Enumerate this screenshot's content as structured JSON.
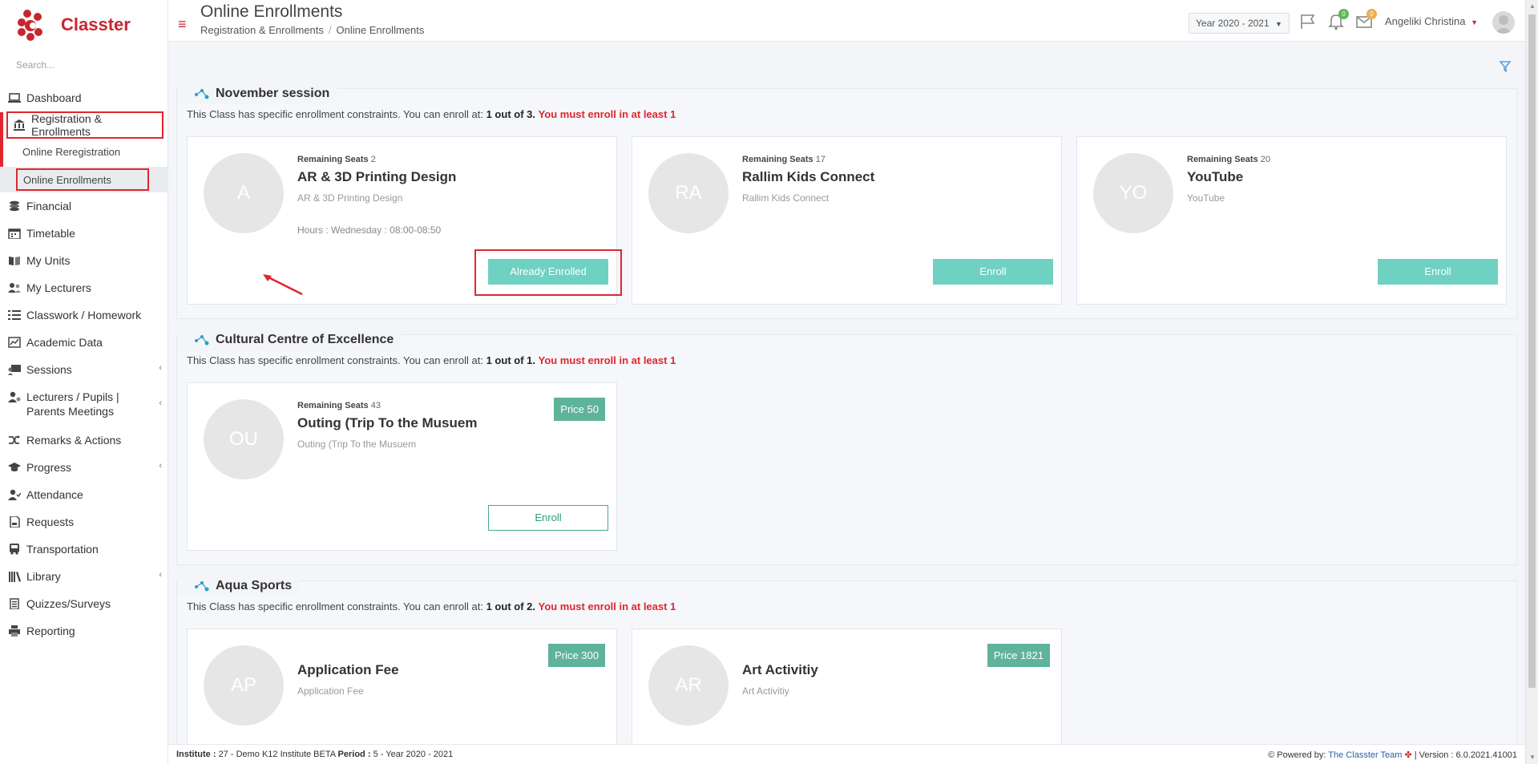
{
  "app": {
    "name": "Classter",
    "search_placeholder": "Search..."
  },
  "sidebar": {
    "items": [
      {
        "label": "Dashboard",
        "icon": "laptop-icon"
      },
      {
        "label": "Registration & Enrollments",
        "icon": "bank-icon"
      },
      {
        "label": "Financial",
        "icon": "coins-icon"
      },
      {
        "label": "Timetable",
        "icon": "calendar-icon"
      },
      {
        "label": "My Units",
        "icon": "book-icon"
      },
      {
        "label": "My Lecturers",
        "icon": "users-icon"
      },
      {
        "label": "Classwork / Homework",
        "icon": "list-icon"
      },
      {
        "label": "Academic Data",
        "icon": "chart-icon"
      },
      {
        "label": "Sessions",
        "icon": "presentation-icon"
      },
      {
        "label": "Lecturers / Pupils | Parents Meetings",
        "icon": "meeting-icon"
      },
      {
        "label": "Remarks & Actions",
        "icon": "shuffle-icon"
      },
      {
        "label": "Progress",
        "icon": "graduation-cap-icon"
      },
      {
        "label": "Attendance",
        "icon": "user-check-icon"
      },
      {
        "label": "Requests",
        "icon": "document-icon"
      },
      {
        "label": "Transportation",
        "icon": "bus-icon"
      },
      {
        "label": "Library",
        "icon": "library-icon"
      },
      {
        "label": "Quizzes/Surveys",
        "icon": "clipboard-icon"
      },
      {
        "label": "Reporting",
        "icon": "printer-icon"
      }
    ],
    "subitems": [
      {
        "label": "Online Reregistration"
      },
      {
        "label": "Online Enrollments"
      }
    ]
  },
  "header": {
    "title": "Online Enrollments",
    "breadcrumb": [
      "Registration & Enrollments",
      "Online Enrollments"
    ],
    "year": "Year 2020 - 2021",
    "notifications_count": "0",
    "messages_count": "0",
    "user_name": "Angeliki Christina"
  },
  "sections": [
    {
      "title": "November session",
      "constraint_prefix": "This Class has specific enrollment constraints. You can enroll at:",
      "constraint_value": "1 out of 3.",
      "constraint_must": "You must enroll in at least 1",
      "cards": [
        {
          "initials": "A",
          "seats_label": "Remaining Seats",
          "seats": "2",
          "name": "AR & 3D Printing Design",
          "subtitle": "AR & 3D Printing Design",
          "hours": "Hours : Wednesday : 08:00-08:50",
          "button": "Already Enrolled"
        },
        {
          "initials": "RA",
          "seats_label": "Remaining Seats",
          "seats": "17",
          "name": "Rallim Kids Connect",
          "subtitle": "Rallim Kids Connect",
          "button": "Enroll"
        },
        {
          "initials": "YO",
          "seats_label": "Remaining Seats",
          "seats": "20",
          "name": "YouTube",
          "subtitle": "YouTube",
          "button": "Enroll"
        }
      ]
    },
    {
      "title": "Cultural Centre of Excellence",
      "constraint_prefix": "This Class has specific enrollment constraints. You can enroll at:",
      "constraint_value": "1 out of 1.",
      "constraint_must": "You must enroll in at least 1",
      "cards": [
        {
          "initials": "OU",
          "seats_label": "Remaining Seats",
          "seats": "43",
          "name": "Outing (Trip To the Musuem",
          "subtitle": "Outing (Trip To the Musuem",
          "price": "Price 50",
          "button": "Enroll"
        }
      ]
    },
    {
      "title": "Aqua Sports",
      "constraint_prefix": "This Class has specific enrollment constraints. You can enroll at:",
      "constraint_value": "1 out of 2.",
      "constraint_must": "You must enroll in at least 1",
      "cards": [
        {
          "initials": "AP",
          "name": "Application Fee",
          "subtitle": "Application Fee",
          "price": "Price 300"
        },
        {
          "initials": "AR",
          "name": "Art Activitiy",
          "subtitle": "Art Activitiy",
          "price": "Price 1821"
        }
      ]
    }
  ],
  "footer": {
    "institute_label": "Institute :",
    "institute_value": "27 - Demo K12 Institute BETA",
    "period_label": "Period :",
    "period_value": "5 - Year 2020 - 2021",
    "powered_label": "Powered by:",
    "powered_link": "The Classter Team",
    "version": "| Version : 6.0.2021.41001"
  },
  "colors": {
    "brand": "#c8262f",
    "enroll_button": "#6fd1c1",
    "price_badge": "#5fb39a",
    "must_text": "#e0262f"
  }
}
